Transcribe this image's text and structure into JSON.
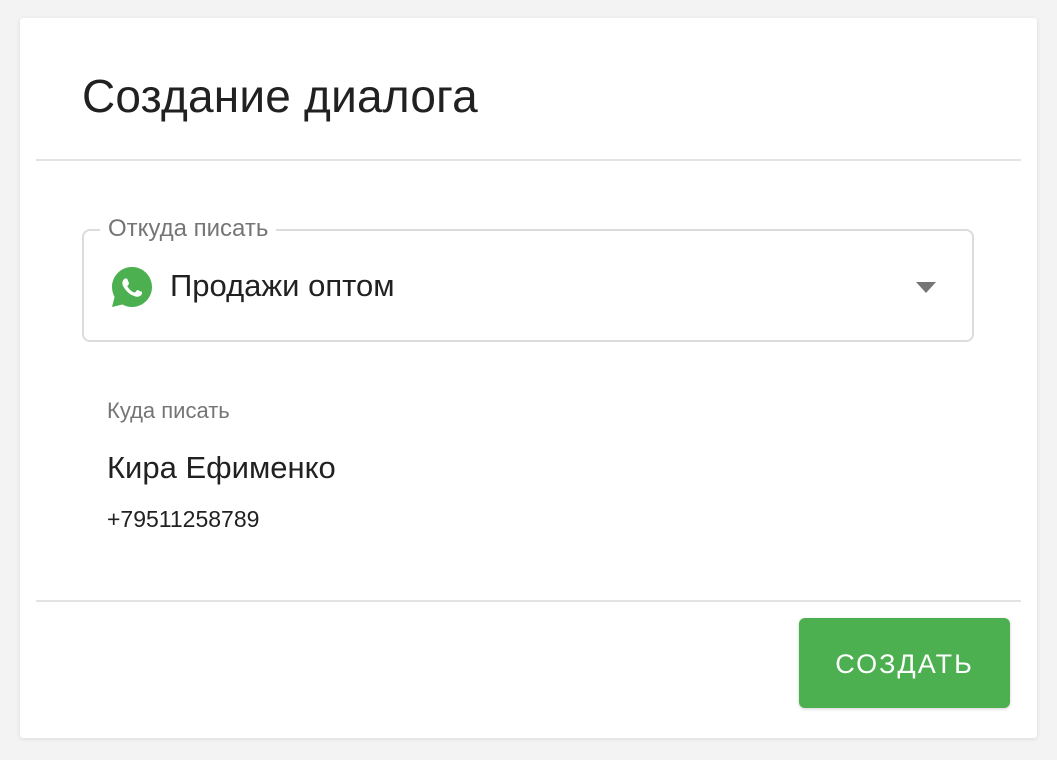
{
  "dialog": {
    "title": "Создание диалога"
  },
  "from_field": {
    "label": "Откуда писать",
    "selected_value": "Продажи оптом",
    "icon": "whatsapp-icon",
    "icon_color": "#4caf50"
  },
  "to_section": {
    "label": "Куда писать",
    "contact_name": "Кира Ефименко",
    "contact_phone": "+79511258789"
  },
  "actions": {
    "create_label": "СОЗДАТЬ",
    "create_color": "#4caf50"
  }
}
